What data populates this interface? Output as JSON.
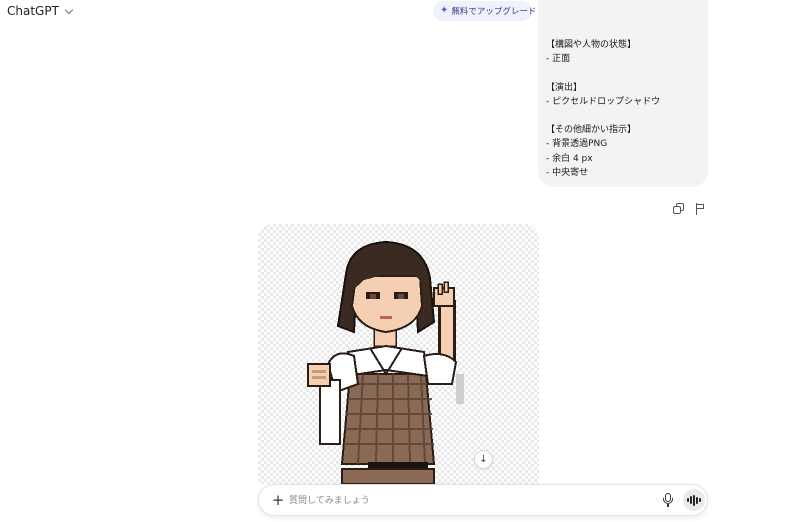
{
  "header": {
    "model_name": "ChatGPT",
    "upgrade_label": "無料でアップグレード",
    "upgrade_close": "×"
  },
  "user_message": {
    "lines": [
      "【構図や人物の状態】",
      "- 正面",
      "",
      "【演出】",
      "- ピクセルドロップシャドウ",
      "",
      "【その他細かい指示】",
      "- 背景透過PNG",
      "- 余白 4 px",
      "- 中央寄せ"
    ]
  },
  "message_actions": {
    "icons": [
      "copy-icon",
      "flag-icon"
    ]
  },
  "generated_image": {
    "subject": "pixel-art-woman-in-plaid-dress",
    "background": "transparent-checkerboard"
  },
  "composer": {
    "placeholder": "質問してみましょう",
    "plus_symbol": "+",
    "icons": [
      "plus-icon",
      "microphone-icon",
      "voice-mode-icon"
    ]
  },
  "scroll_button": {
    "symbol": "↓"
  },
  "colors": {
    "bubble_bg": "#f3f3f3",
    "upgrade_bg": "#f1f1fb",
    "upgrade_accent": "#5a5bd6",
    "hair": "#3a2a22",
    "skin": "#f4cfb2",
    "plaid": "#8a6a55",
    "collar": "#ffffff"
  }
}
